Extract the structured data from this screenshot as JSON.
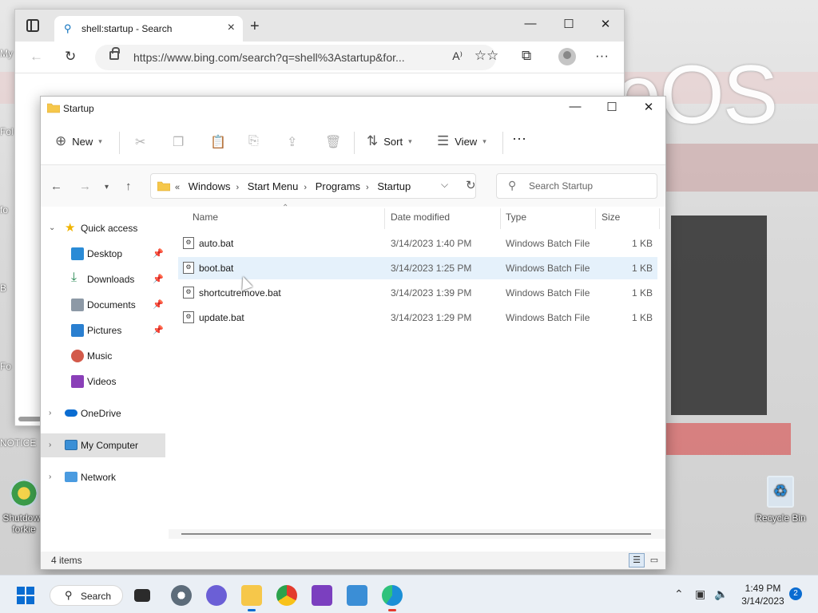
{
  "desktop": {
    "bg_text": "eOS",
    "icons": [
      {
        "label": "Recycle Bin",
        "name": "recycle-bin"
      },
      {
        "label": "Shutdown",
        "label2": "forkie",
        "name": "shutdown"
      }
    ],
    "left_fragments": [
      "My",
      "Fol",
      "fo",
      "B",
      "Fo",
      "NOTICE"
    ]
  },
  "browser": {
    "tab_title": "shell:startup - Search",
    "url": "https://www.bing.com/search?q=shell%3Astartup&for..."
  },
  "explorer": {
    "title": "Startup",
    "toolbar": {
      "new_label": "New",
      "sort_label": "Sort",
      "view_label": "View",
      "more_label": "···"
    },
    "breadcrumb": [
      "Windows",
      "Start Menu",
      "Programs",
      "Startup"
    ],
    "breadcrumb_prefix": "«",
    "search_placeholder": "Search Startup",
    "nav": {
      "quick_access": "Quick access",
      "items": [
        {
          "label": "Desktop",
          "icon": "desktop-icon",
          "color": "#2a8bd6"
        },
        {
          "label": "Downloads",
          "icon": "download-icon",
          "color": "#2e8b57"
        },
        {
          "label": "Documents",
          "icon": "documents-icon",
          "color": "#7d8a96"
        },
        {
          "label": "Pictures",
          "icon": "pictures-icon",
          "color": "#2a7fd0"
        },
        {
          "label": "Music",
          "icon": "music-icon",
          "color": "#d35a4a"
        },
        {
          "label": "Videos",
          "icon": "videos-icon",
          "color": "#8a3fb8"
        }
      ],
      "onedrive": "OneDrive",
      "my_computer": "My Computer",
      "network": "Network"
    },
    "columns": [
      "Name",
      "Date modified",
      "Type",
      "Size"
    ],
    "files": [
      {
        "name": "auto.bat",
        "date": "3/14/2023 1:40 PM",
        "type": "Windows Batch File",
        "size": "1 KB"
      },
      {
        "name": "boot.bat",
        "date": "3/14/2023 1:25 PM",
        "type": "Windows Batch File",
        "size": "1 KB"
      },
      {
        "name": "shortcutremove.bat",
        "date": "3/14/2023 1:39 PM",
        "type": "Windows Batch File",
        "size": "1 KB"
      },
      {
        "name": "update.bat",
        "date": "3/14/2023 1:29 PM",
        "type": "Windows Batch File",
        "size": "1 KB"
      }
    ],
    "status": "4 items"
  },
  "taskbar": {
    "search_label": "Search",
    "time": "1:49 PM",
    "date": "3/14/2023",
    "notification_count": "2"
  }
}
